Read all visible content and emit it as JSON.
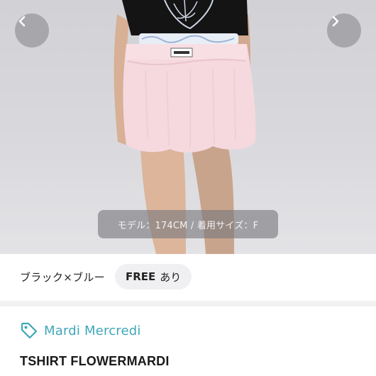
{
  "image": {
    "caption": "モデル：174CM / 着用サイズ：F"
  },
  "nav": {
    "prev_icon": "chevron-left-icon",
    "next_icon": "chevron-right-icon"
  },
  "variant": {
    "color": "ブラック×ブルー",
    "size_label": "FREE",
    "availability": "あり"
  },
  "brand": {
    "icon": "tag-icon",
    "name": "Mardi Mercredi",
    "accent_color": "#3fa7b8"
  },
  "product": {
    "name": "TSHIRT FLOWERMARDI"
  }
}
